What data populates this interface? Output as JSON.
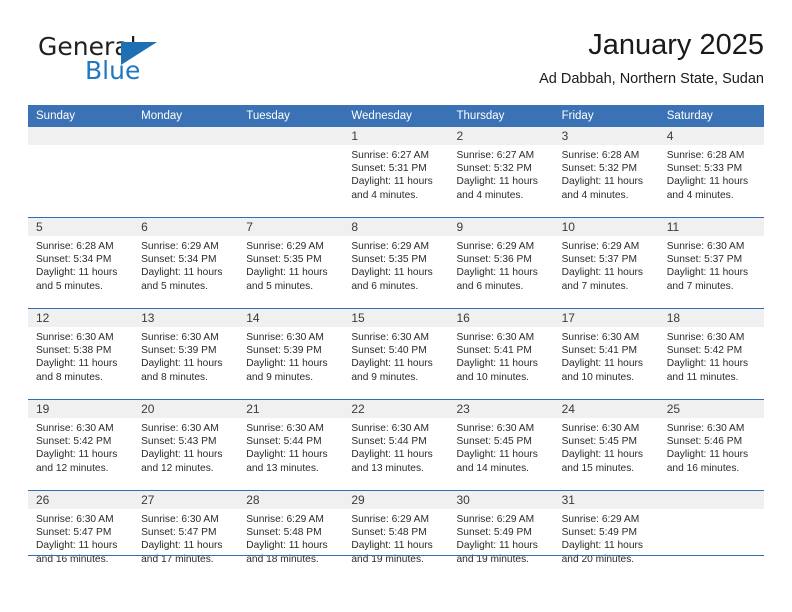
{
  "brand": {
    "name_top": "General",
    "name_bottom": "Blue",
    "color_dark": "#231f20",
    "color_blue": "#1f78c1"
  },
  "header": {
    "title": "January 2025",
    "subtitle": "Ad Dabbah, Northern State, Sudan"
  },
  "theme": {
    "header_blue": "#3a72b5",
    "rule_blue": "#2f6eb5",
    "daynum_strip": "#f0f0f0",
    "text": "#2b2b2b"
  },
  "weekdays": [
    "Sunday",
    "Monday",
    "Tuesday",
    "Wednesday",
    "Thursday",
    "Friday",
    "Saturday"
  ],
  "weeks": [
    [
      {
        "day": ""
      },
      {
        "day": ""
      },
      {
        "day": ""
      },
      {
        "day": "1",
        "sunrise": "Sunrise: 6:27 AM",
        "sunset": "Sunset: 5:31 PM",
        "daylight1": "Daylight: 11 hours",
        "daylight2": "and 4 minutes."
      },
      {
        "day": "2",
        "sunrise": "Sunrise: 6:27 AM",
        "sunset": "Sunset: 5:32 PM",
        "daylight1": "Daylight: 11 hours",
        "daylight2": "and 4 minutes."
      },
      {
        "day": "3",
        "sunrise": "Sunrise: 6:28 AM",
        "sunset": "Sunset: 5:32 PM",
        "daylight1": "Daylight: 11 hours",
        "daylight2": "and 4 minutes."
      },
      {
        "day": "4",
        "sunrise": "Sunrise: 6:28 AM",
        "sunset": "Sunset: 5:33 PM",
        "daylight1": "Daylight: 11 hours",
        "daylight2": "and 4 minutes."
      }
    ],
    [
      {
        "day": "5",
        "sunrise": "Sunrise: 6:28 AM",
        "sunset": "Sunset: 5:34 PM",
        "daylight1": "Daylight: 11 hours",
        "daylight2": "and 5 minutes."
      },
      {
        "day": "6",
        "sunrise": "Sunrise: 6:29 AM",
        "sunset": "Sunset: 5:34 PM",
        "daylight1": "Daylight: 11 hours",
        "daylight2": "and 5 minutes."
      },
      {
        "day": "7",
        "sunrise": "Sunrise: 6:29 AM",
        "sunset": "Sunset: 5:35 PM",
        "daylight1": "Daylight: 11 hours",
        "daylight2": "and 5 minutes."
      },
      {
        "day": "8",
        "sunrise": "Sunrise: 6:29 AM",
        "sunset": "Sunset: 5:35 PM",
        "daylight1": "Daylight: 11 hours",
        "daylight2": "and 6 minutes."
      },
      {
        "day": "9",
        "sunrise": "Sunrise: 6:29 AM",
        "sunset": "Sunset: 5:36 PM",
        "daylight1": "Daylight: 11 hours",
        "daylight2": "and 6 minutes."
      },
      {
        "day": "10",
        "sunrise": "Sunrise: 6:29 AM",
        "sunset": "Sunset: 5:37 PM",
        "daylight1": "Daylight: 11 hours",
        "daylight2": "and 7 minutes."
      },
      {
        "day": "11",
        "sunrise": "Sunrise: 6:30 AM",
        "sunset": "Sunset: 5:37 PM",
        "daylight1": "Daylight: 11 hours",
        "daylight2": "and 7 minutes."
      }
    ],
    [
      {
        "day": "12",
        "sunrise": "Sunrise: 6:30 AM",
        "sunset": "Sunset: 5:38 PM",
        "daylight1": "Daylight: 11 hours",
        "daylight2": "and 8 minutes."
      },
      {
        "day": "13",
        "sunrise": "Sunrise: 6:30 AM",
        "sunset": "Sunset: 5:39 PM",
        "daylight1": "Daylight: 11 hours",
        "daylight2": "and 8 minutes."
      },
      {
        "day": "14",
        "sunrise": "Sunrise: 6:30 AM",
        "sunset": "Sunset: 5:39 PM",
        "daylight1": "Daylight: 11 hours",
        "daylight2": "and 9 minutes."
      },
      {
        "day": "15",
        "sunrise": "Sunrise: 6:30 AM",
        "sunset": "Sunset: 5:40 PM",
        "daylight1": "Daylight: 11 hours",
        "daylight2": "and 9 minutes."
      },
      {
        "day": "16",
        "sunrise": "Sunrise: 6:30 AM",
        "sunset": "Sunset: 5:41 PM",
        "daylight1": "Daylight: 11 hours",
        "daylight2": "and 10 minutes."
      },
      {
        "day": "17",
        "sunrise": "Sunrise: 6:30 AM",
        "sunset": "Sunset: 5:41 PM",
        "daylight1": "Daylight: 11 hours",
        "daylight2": "and 10 minutes."
      },
      {
        "day": "18",
        "sunrise": "Sunrise: 6:30 AM",
        "sunset": "Sunset: 5:42 PM",
        "daylight1": "Daylight: 11 hours",
        "daylight2": "and 11 minutes."
      }
    ],
    [
      {
        "day": "19",
        "sunrise": "Sunrise: 6:30 AM",
        "sunset": "Sunset: 5:42 PM",
        "daylight1": "Daylight: 11 hours",
        "daylight2": "and 12 minutes."
      },
      {
        "day": "20",
        "sunrise": "Sunrise: 6:30 AM",
        "sunset": "Sunset: 5:43 PM",
        "daylight1": "Daylight: 11 hours",
        "daylight2": "and 12 minutes."
      },
      {
        "day": "21",
        "sunrise": "Sunrise: 6:30 AM",
        "sunset": "Sunset: 5:44 PM",
        "daylight1": "Daylight: 11 hours",
        "daylight2": "and 13 minutes."
      },
      {
        "day": "22",
        "sunrise": "Sunrise: 6:30 AM",
        "sunset": "Sunset: 5:44 PM",
        "daylight1": "Daylight: 11 hours",
        "daylight2": "and 13 minutes."
      },
      {
        "day": "23",
        "sunrise": "Sunrise: 6:30 AM",
        "sunset": "Sunset: 5:45 PM",
        "daylight1": "Daylight: 11 hours",
        "daylight2": "and 14 minutes."
      },
      {
        "day": "24",
        "sunrise": "Sunrise: 6:30 AM",
        "sunset": "Sunset: 5:45 PM",
        "daylight1": "Daylight: 11 hours",
        "daylight2": "and 15 minutes."
      },
      {
        "day": "25",
        "sunrise": "Sunrise: 6:30 AM",
        "sunset": "Sunset: 5:46 PM",
        "daylight1": "Daylight: 11 hours",
        "daylight2": "and 16 minutes."
      }
    ],
    [
      {
        "day": "26",
        "sunrise": "Sunrise: 6:30 AM",
        "sunset": "Sunset: 5:47 PM",
        "daylight1": "Daylight: 11 hours",
        "daylight2": "and 16 minutes."
      },
      {
        "day": "27",
        "sunrise": "Sunrise: 6:30 AM",
        "sunset": "Sunset: 5:47 PM",
        "daylight1": "Daylight: 11 hours",
        "daylight2": "and 17 minutes."
      },
      {
        "day": "28",
        "sunrise": "Sunrise: 6:29 AM",
        "sunset": "Sunset: 5:48 PM",
        "daylight1": "Daylight: 11 hours",
        "daylight2": "and 18 minutes."
      },
      {
        "day": "29",
        "sunrise": "Sunrise: 6:29 AM",
        "sunset": "Sunset: 5:48 PM",
        "daylight1": "Daylight: 11 hours",
        "daylight2": "and 19 minutes."
      },
      {
        "day": "30",
        "sunrise": "Sunrise: 6:29 AM",
        "sunset": "Sunset: 5:49 PM",
        "daylight1": "Daylight: 11 hours",
        "daylight2": "and 19 minutes."
      },
      {
        "day": "31",
        "sunrise": "Sunrise: 6:29 AM",
        "sunset": "Sunset: 5:49 PM",
        "daylight1": "Daylight: 11 hours",
        "daylight2": "and 20 minutes."
      },
      {
        "day": ""
      }
    ]
  ]
}
